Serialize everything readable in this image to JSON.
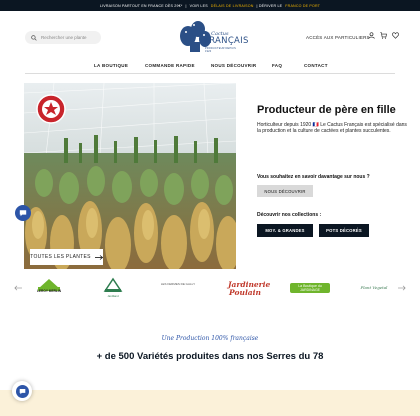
{
  "announcement": {
    "part1": "LIVRAISON PARTOUT EN FRANCE DÈS 29€*",
    "sep": "|",
    "part2": "VOIR LES",
    "link1": "DÉLAIS DE LIVRAISON",
    "part3": "| DÉRIVER LE",
    "link2": "FRANCO DE PORT"
  },
  "header": {
    "search_placeholder": "Rechercher une plante",
    "logo": {
      "line1": "le Cactus",
      "line2": "FRANÇAIS",
      "line3": "PRODUCTEUR DEPUIS 1920"
    },
    "pro_access": "ACCÈS AUX PARTICULIERS"
  },
  "nav": [
    "LA BOUTIQUE",
    "COMMANDE RAPIDE",
    "NOUS DÉCOUVRIR",
    "FAQ",
    "CONTACT"
  ],
  "hero": {
    "button_label": "TOUTES LES PLANTES",
    "badge_text": "Producteur"
  },
  "intro": {
    "heading": "Producteur de père en fille",
    "paragraph": "Horticulteur depuis 1920 🇫🇷 Le Cactus Français est spécialisé dans la production et la culture de cactées et plantes succulentes.",
    "question": "Vous souhaitez en savoir davantage sur nous ?",
    "about_button": "NOUS DÉCOUVRIR",
    "collections_label": "Découvrir nos collections :",
    "collection_buttons": [
      "MOY. & GRANDES",
      "POTS DÉCORÉS"
    ]
  },
  "brands": [
    "LEROY MERLIN",
    "Jardiland",
    "LES FERMES DE GALLY",
    "Jardinerie Poulain",
    "La Boutique du JARDINAGE",
    "Plant Vegetal"
  ],
  "production": {
    "script": "Une Production 100% française",
    "title": "+ de 500 Variétés produites dans nos Serres du 78"
  },
  "colors": {
    "navy": "#0b1622",
    "brand_blue": "#2d55a8",
    "accent_yellow": "#f2b400",
    "cream": "#fbf1d9"
  }
}
